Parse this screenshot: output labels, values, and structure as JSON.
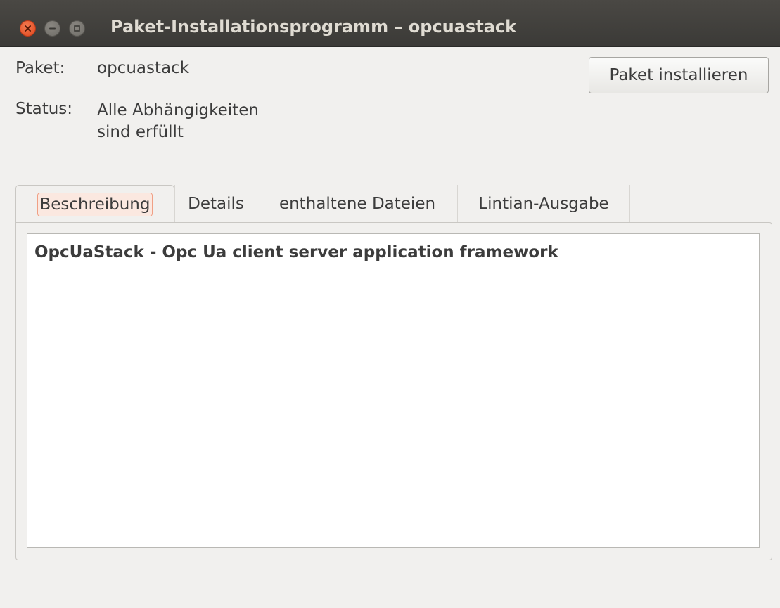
{
  "window": {
    "title": "Paket-Installationsprogramm – opcuastack",
    "controls": {
      "close_icon": "close-icon",
      "minimize_icon": "minimize-icon",
      "maximize_icon": "maximize-icon"
    }
  },
  "info": {
    "package_key": "Paket:",
    "package_value": "opcuastack",
    "status_key": "Status:",
    "status_value": "Alle Abhängigkeiten sind erfüllt"
  },
  "actions": {
    "install_label": "Paket installieren"
  },
  "tabs": [
    {
      "label": "Beschreibung",
      "active": true
    },
    {
      "label": "Details",
      "active": false
    },
    {
      "label": "enthaltene Dateien",
      "active": false
    },
    {
      "label": "Lintian-Ausgabe",
      "active": false
    }
  ],
  "description": {
    "text": "OpcUaStack - Opc Ua client server application framework"
  },
  "colors": {
    "titlebar": "#3c3b37",
    "close_button": "#e4511f",
    "active_tab_highlight": "#f0a085",
    "window_bg": "#f1f0ee"
  }
}
